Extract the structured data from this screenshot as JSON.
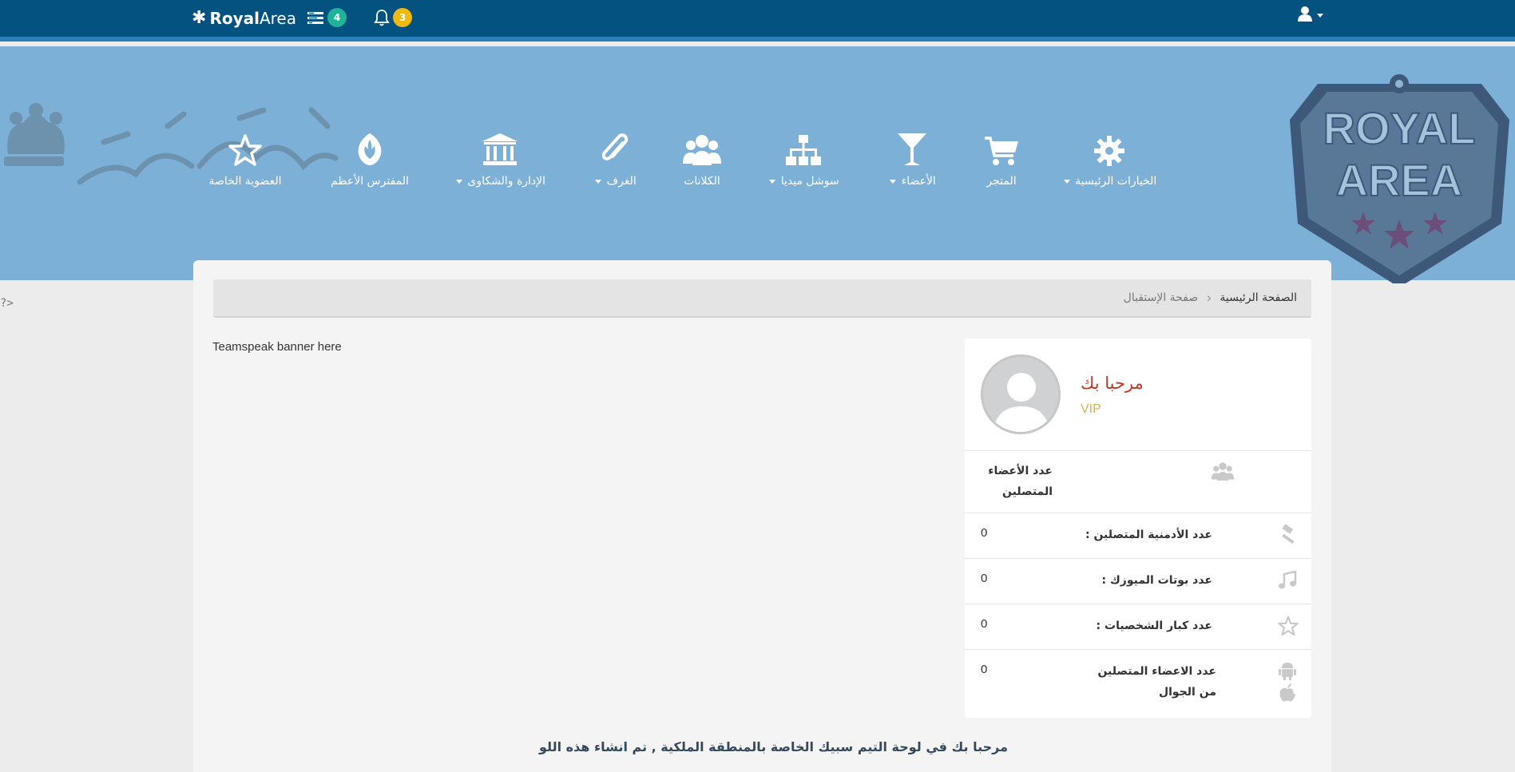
{
  "topbar": {
    "brand_bold": "Royal",
    "brand_regular": "Area",
    "tasks_badge": "4",
    "notifications_badge": "3"
  },
  "nav": [
    {
      "label": "العضوية الخاصة",
      "icon": "star-icon",
      "dropdown": false
    },
    {
      "label": "المفترس الأعظم",
      "icon": "rebel-icon",
      "dropdown": false
    },
    {
      "label": "الإدارة والشكاوى",
      "icon": "bank-icon",
      "dropdown": true
    },
    {
      "label": "الغرف",
      "icon": "paperclip-icon",
      "dropdown": true
    },
    {
      "label": "الكلانات",
      "icon": "users-icon",
      "dropdown": false
    },
    {
      "label": "سوشل ميديا",
      "icon": "sitemap-icon",
      "dropdown": true
    },
    {
      "label": "الأعضاء",
      "icon": "glass-icon",
      "dropdown": true
    },
    {
      "label": "المتجر",
      "icon": "cart-icon",
      "dropdown": false
    },
    {
      "label": "الخيارات الرئيسية",
      "icon": "gear-icon",
      "dropdown": true
    }
  ],
  "logo": {
    "line1": "ROYAL",
    "line2": "AREA"
  },
  "page_marker": "?>",
  "breadcrumb": {
    "home": "الصفحة الرئيسية",
    "current": "صفحة الإستقبال"
  },
  "teamspeak_banner": "Teamspeak banner here",
  "profile": {
    "welcome": "مرحبا بك",
    "rank": "VIP"
  },
  "stats": [
    {
      "label": "عدد الأعضاء المتصلين",
      "value": "",
      "icon": "users-icon"
    },
    {
      "label": "عدد الأدمنية المتصلين :",
      "value": "0",
      "icon": "gavel-icon"
    },
    {
      "label": "عدد بوتات الميوزك :",
      "value": "0",
      "icon": "music-icon"
    },
    {
      "label": "عدد كبار الشخصيات :",
      "value": "0",
      "icon": "star-outline-icon"
    },
    {
      "label": "عدد الاعضاء المتصلين من الجوال",
      "value": "0",
      "icon": "mobile-icons"
    }
  ],
  "footer_text": "مرحبا بك في لوحة التيم سبيك الخاصة بالمنطقة الملكية , تم انشاء هذه اللو"
}
